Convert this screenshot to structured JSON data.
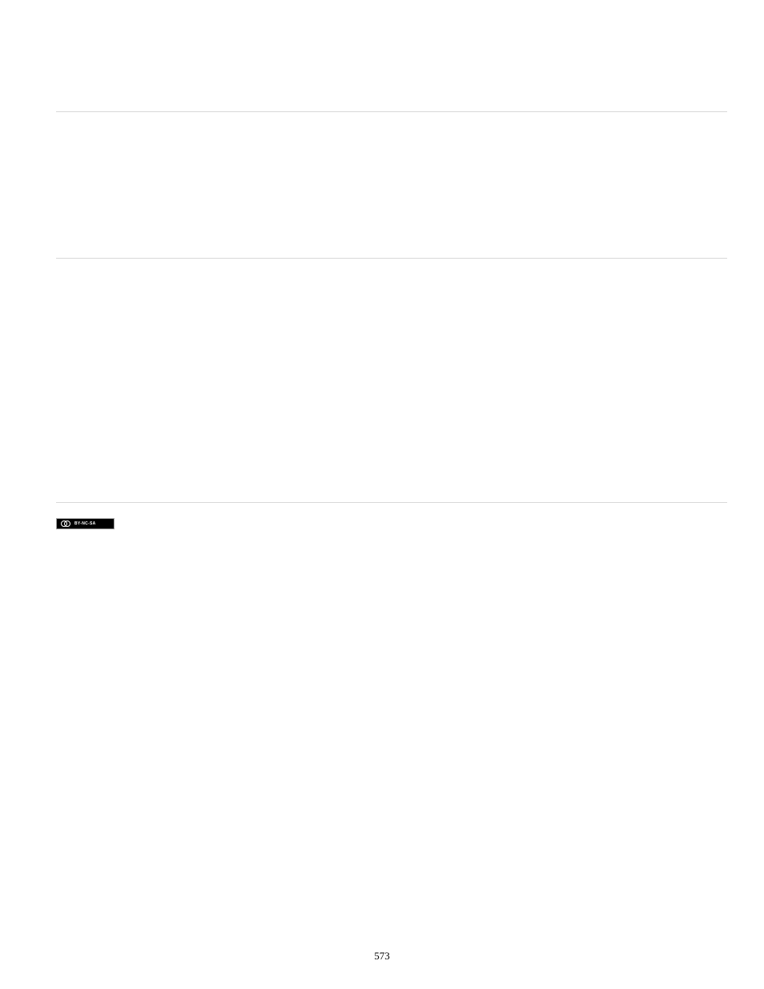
{
  "license": {
    "badge_text": "BY-NC-SA"
  },
  "page": {
    "number": "573"
  }
}
